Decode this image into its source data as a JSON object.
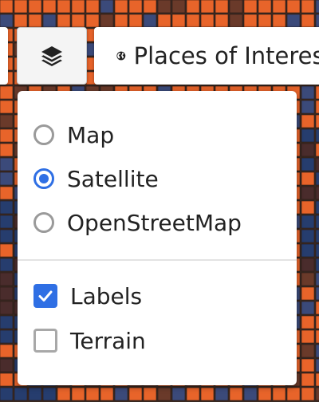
{
  "toolbar": {
    "layers_icon": "layers-icon",
    "poi_icon": "globe-icon",
    "poi_label": "Places of Interest"
  },
  "layer_panel": {
    "base_layers": [
      {
        "label": "Map",
        "selected": false
      },
      {
        "label": "Satellite",
        "selected": true
      },
      {
        "label": "OpenStreetMap",
        "selected": false
      }
    ],
    "overlays": [
      {
        "label": "Labels",
        "checked": true
      },
      {
        "label": "Terrain",
        "checked": false
      }
    ]
  },
  "colors": {
    "accent": "#2f6fe4",
    "map_orange": "#e8642a",
    "map_blue": "#263d6e"
  }
}
